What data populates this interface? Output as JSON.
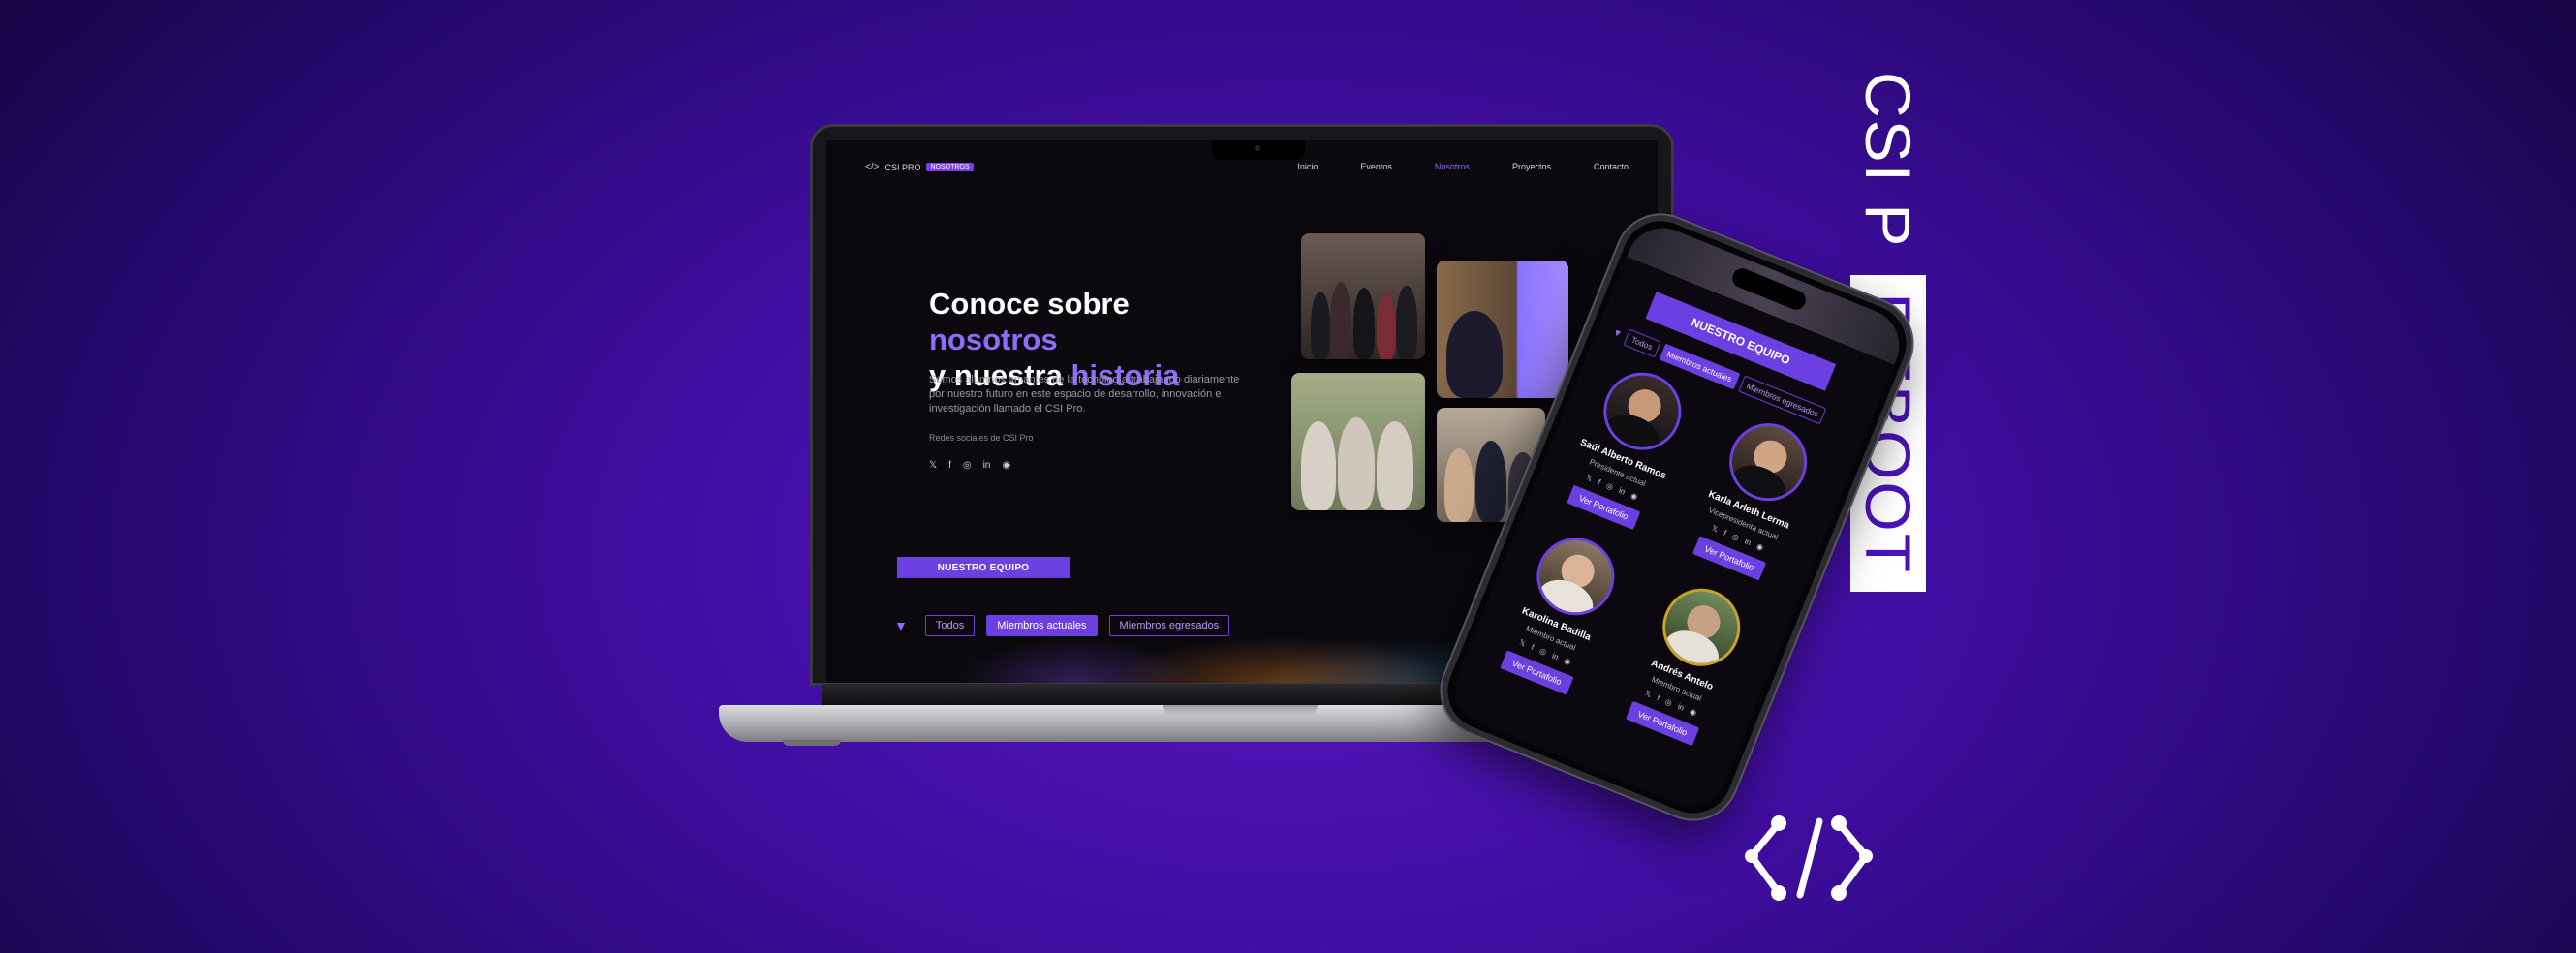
{
  "brand_panel": {
    "title_part1": "CSI P",
    "title_part2": "REBOOT"
  },
  "laptop_site": {
    "nav": {
      "brand": "CSI PRO",
      "badge": "NOSOTROS",
      "links": [
        "Inicio",
        "Eventos",
        "Nosotros",
        "Proyectos",
        "Contacto"
      ]
    },
    "hero": {
      "title_line1_a": "Conoce sobre ",
      "title_line1_b": "nosotros",
      "title_line2_a": "y nuestra ",
      "title_line2_b": "historia",
      "description": "Somos alumnos amantes de la tecnología trabajando diariamente por nuestro futuro en este espacio de desarrollo, innovación e investigación llamado el CSI Pro.",
      "social_label": "Redes sociales de CSI Pro"
    },
    "team_button": "NUESTRO EQUIPO",
    "filters": [
      "Todos",
      "Miembros actuales",
      "Miembros egresados"
    ]
  },
  "phone_site": {
    "team_button": "NUESTRO EQUIPO",
    "filters": [
      "Todos",
      "Miembros actuales",
      "Miembros egresados"
    ],
    "members": [
      {
        "name": "Saúl Alberto Ramos",
        "role": "Presidente actual",
        "button": "Ver Portafolio"
      },
      {
        "name": "Karla Arleth Lerma",
        "role": "Vicepresidenta actual",
        "button": "Ver Portafolio"
      },
      {
        "name": "Karolina Badilla",
        "role": "Miembro actual",
        "button": "Ver Portafolio"
      },
      {
        "name": "Andrés Antelo",
        "role": "Miembro actual",
        "button": "Ver Portafolio"
      }
    ]
  },
  "social_icons": [
    "x-icon",
    "facebook-icon",
    "instagram-icon",
    "linkedin-icon",
    "github-icon"
  ],
  "colors": {
    "accent": "#6c3fe0",
    "highlight": "#8f6bff",
    "background": "#3e0d9e"
  }
}
